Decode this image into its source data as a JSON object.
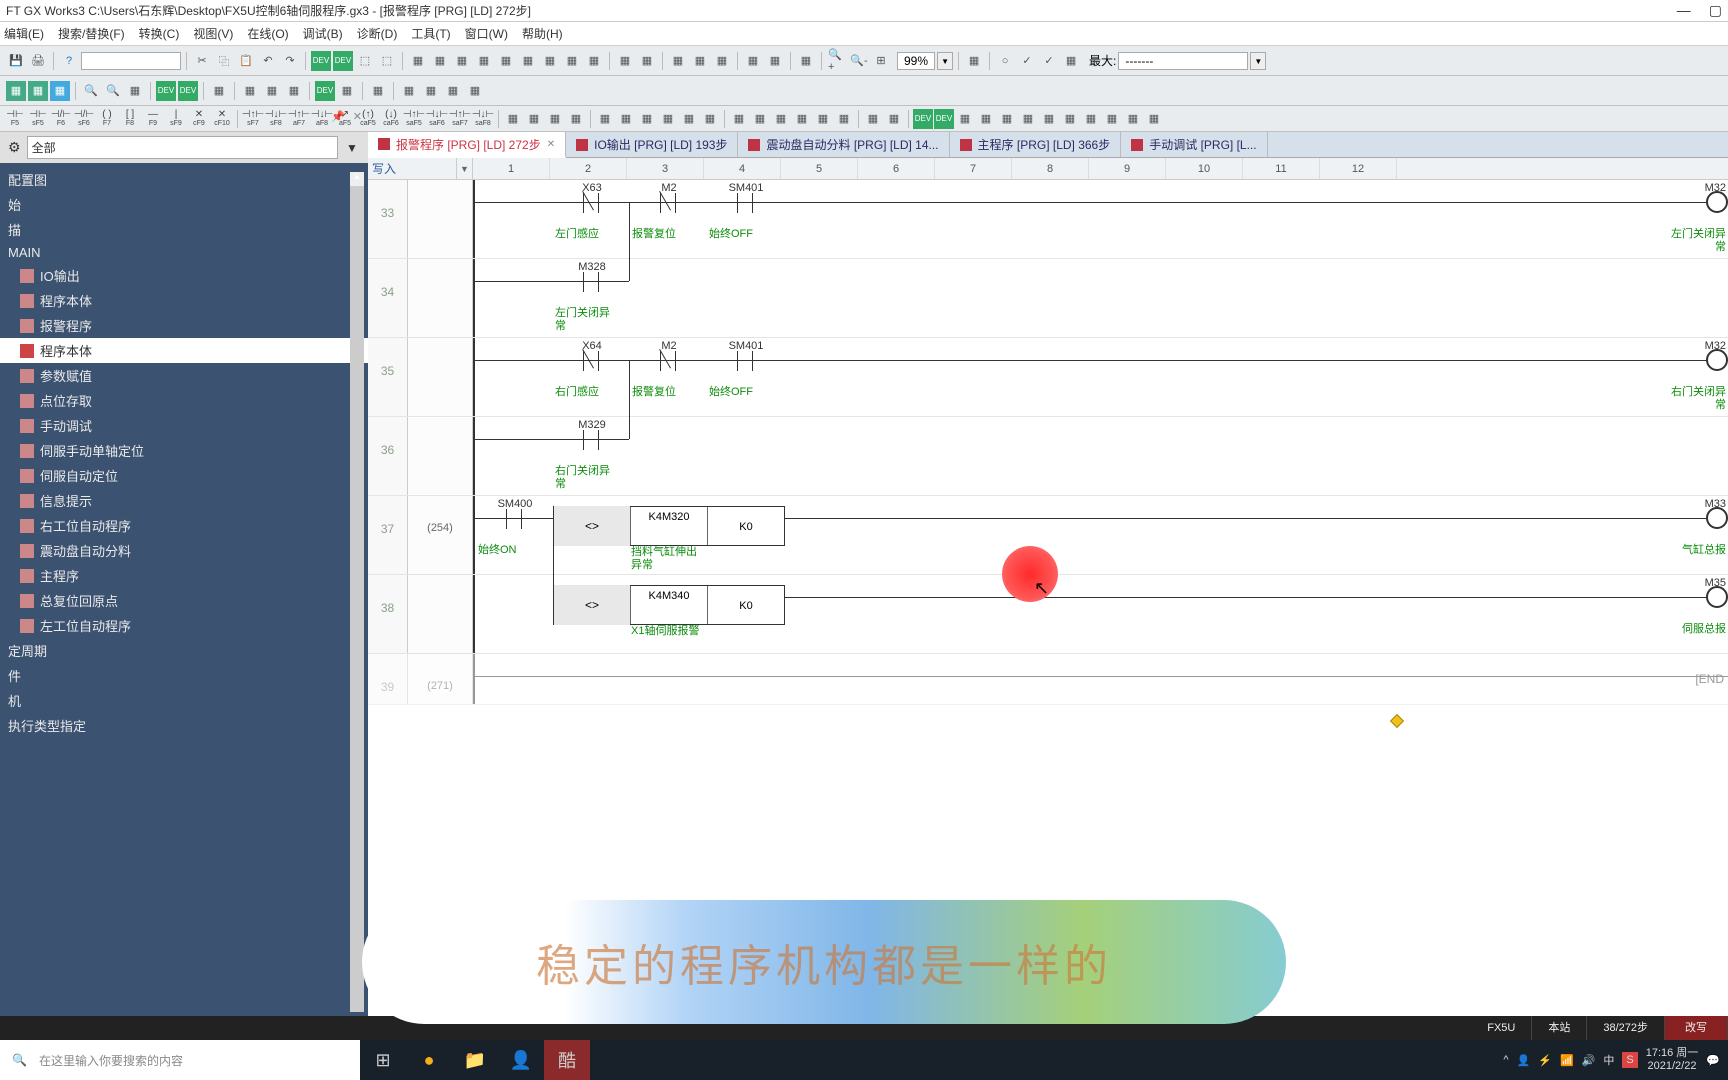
{
  "window": {
    "title": "FT GX Works3 C:\\Users\\石东辉\\Desktop\\FX5U控制6轴伺服程序.gx3 - [报警程序 [PRG] [LD] 272步]"
  },
  "menu": {
    "items": [
      "编辑(E)",
      "搜索/替换(F)",
      "转换(C)",
      "视图(V)",
      "在线(O)",
      "调试(B)",
      "诊断(D)",
      "工具(T)",
      "窗口(W)",
      "帮助(H)"
    ]
  },
  "zoom": {
    "value": "99%",
    "max_label": "最大:",
    "max_value": "-------"
  },
  "nav": {
    "filter_label": "全部",
    "items": [
      {
        "label": "配置图",
        "lvl": "l1"
      },
      {
        "label": "始",
        "lvl": "l1"
      },
      {
        "label": "描",
        "lvl": "l1"
      },
      {
        "label": "MAIN",
        "lvl": "l1"
      },
      {
        "label": "IO输出",
        "lvl": "l2",
        "ic": true
      },
      {
        "label": "程序本体",
        "lvl": "l2",
        "ic": true
      },
      {
        "label": "报警程序",
        "lvl": "l2",
        "ic": true
      },
      {
        "label": "程序本体",
        "lvl": "l2",
        "ic": true,
        "selected": true
      },
      {
        "label": "参数赋值",
        "lvl": "l2",
        "ic": true
      },
      {
        "label": "点位存取",
        "lvl": "l2",
        "ic": true
      },
      {
        "label": "手动调试",
        "lvl": "l2",
        "ic": true
      },
      {
        "label": "伺服手动单轴定位",
        "lvl": "l2",
        "ic": true
      },
      {
        "label": "伺服自动定位",
        "lvl": "l2",
        "ic": true
      },
      {
        "label": "信息提示",
        "lvl": "l2",
        "ic": true
      },
      {
        "label": "右工位自动程序",
        "lvl": "l2",
        "ic": true
      },
      {
        "label": "震动盘自动分料",
        "lvl": "l2",
        "ic": true
      },
      {
        "label": "主程序",
        "lvl": "l2",
        "ic": true
      },
      {
        "label": "总复位回原点",
        "lvl": "l2",
        "ic": true
      },
      {
        "label": "左工位自动程序",
        "lvl": "l2",
        "ic": true
      },
      {
        "label": "定周期",
        "lvl": "l1"
      },
      {
        "label": "件",
        "lvl": "l1"
      },
      {
        "label": "机",
        "lvl": "l1"
      },
      {
        "label": "执行类型指定",
        "lvl": "l1"
      }
    ]
  },
  "tabs": [
    {
      "label": "报警程序 [PRG] [LD] 272步",
      "active": true,
      "close": true
    },
    {
      "label": "IO输出 [PRG] [LD] 193步"
    },
    {
      "label": "震动盘自动分料 [PRG] [LD] 14..."
    },
    {
      "label": "主程序 [PRG] [LD] 366步"
    },
    {
      "label": "手动调试 [PRG] [L..."
    }
  ],
  "cols": {
    "mode": "写入",
    "nums": [
      "1",
      "2",
      "3",
      "4",
      "5",
      "6",
      "7",
      "8",
      "9",
      "10",
      "11",
      "12"
    ]
  },
  "rungs": {
    "r33": {
      "num": "33",
      "dev1": "X63",
      "c1": "左门感应",
      "dev2": "M2",
      "c2": "报警复位",
      "dev3": "SM401",
      "c3": "始终OFF",
      "out": "M32",
      "outc": "左门关闭异常"
    },
    "r34": {
      "num": "34",
      "dev1": "M328",
      "c1": "左门关闭异常"
    },
    "r35": {
      "num": "35",
      "dev1": "X64",
      "c1": "右门感应",
      "dev2": "M2",
      "c2": "报警复位",
      "dev3": "SM401",
      "c3": "始终OFF",
      "out": "M32",
      "outc": "右门关闭异常"
    },
    "r36": {
      "num": "36",
      "dev1": "M329",
      "c1": "右门关闭异常"
    },
    "r37": {
      "num": "37",
      "step": "(254)",
      "dev1": "SM400",
      "c1": "始终ON",
      "op": "<>",
      "p1": "K4M320",
      "p1c": "挡料气缸伸出异常",
      "p2": "K0",
      "out": "M33",
      "outc": "气缸总报"
    },
    "r38": {
      "num": "38",
      "op": "<>",
      "p1": "K4M340",
      "p1c": "X1轴伺服报警",
      "p2": "K0",
      "out": "M35",
      "outc": "伺服总报"
    },
    "r39": {
      "num": "39",
      "step": "(271)",
      "end": "[END"
    }
  },
  "subtitle": "稳定的程序机构都是一样的",
  "status": {
    "plc": "FX5U",
    "station": "本站",
    "step": "38/272步",
    "edit": "改写"
  },
  "taskbar": {
    "search_placeholder": "在这里输入你要搜索的内容",
    "time": "17:16 周一",
    "date": "2021/2/22"
  }
}
